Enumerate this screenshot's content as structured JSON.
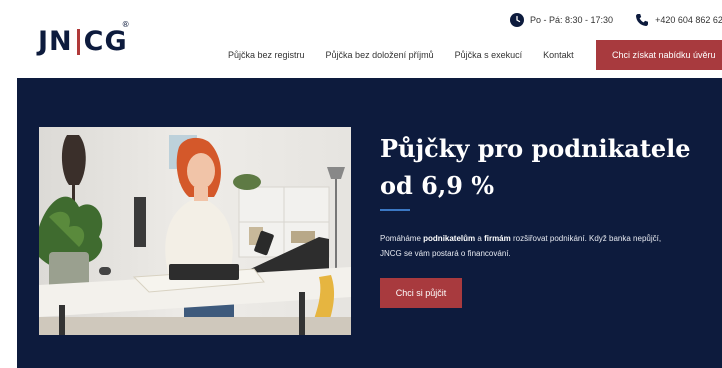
{
  "header": {
    "logo": {
      "left": "JN",
      "right": "CG",
      "reg": "®"
    },
    "hours": "Po - Pá: 8:30 - 17:30",
    "phone": "+420 604 862 62",
    "nav": [
      "Půjčka bez registru",
      "Půjčka bez doložení příjmů",
      "Půjčka s exekucí",
      "Kontakt"
    ],
    "cta": "Chci získat nabídku úvěru"
  },
  "hero": {
    "title_line1": "Půjčky pro podnikatele",
    "title_line2": "od 6,9 %",
    "desc": {
      "p1": "Pomáháme ",
      "b1": "podnikatelům",
      "p2": " a ",
      "b2": "firmám",
      "p3": " rozšiřovat podnikání. Když banka nepůjčí, JNCG se vám postará o financování."
    },
    "cta": "Chci si půjčit"
  },
  "colors": {
    "navy": "#0d1b3d",
    "accent_red": "#a83a3e",
    "divider_blue": "#3b78c4"
  },
  "icons": [
    "clock-icon",
    "phone-icon"
  ]
}
